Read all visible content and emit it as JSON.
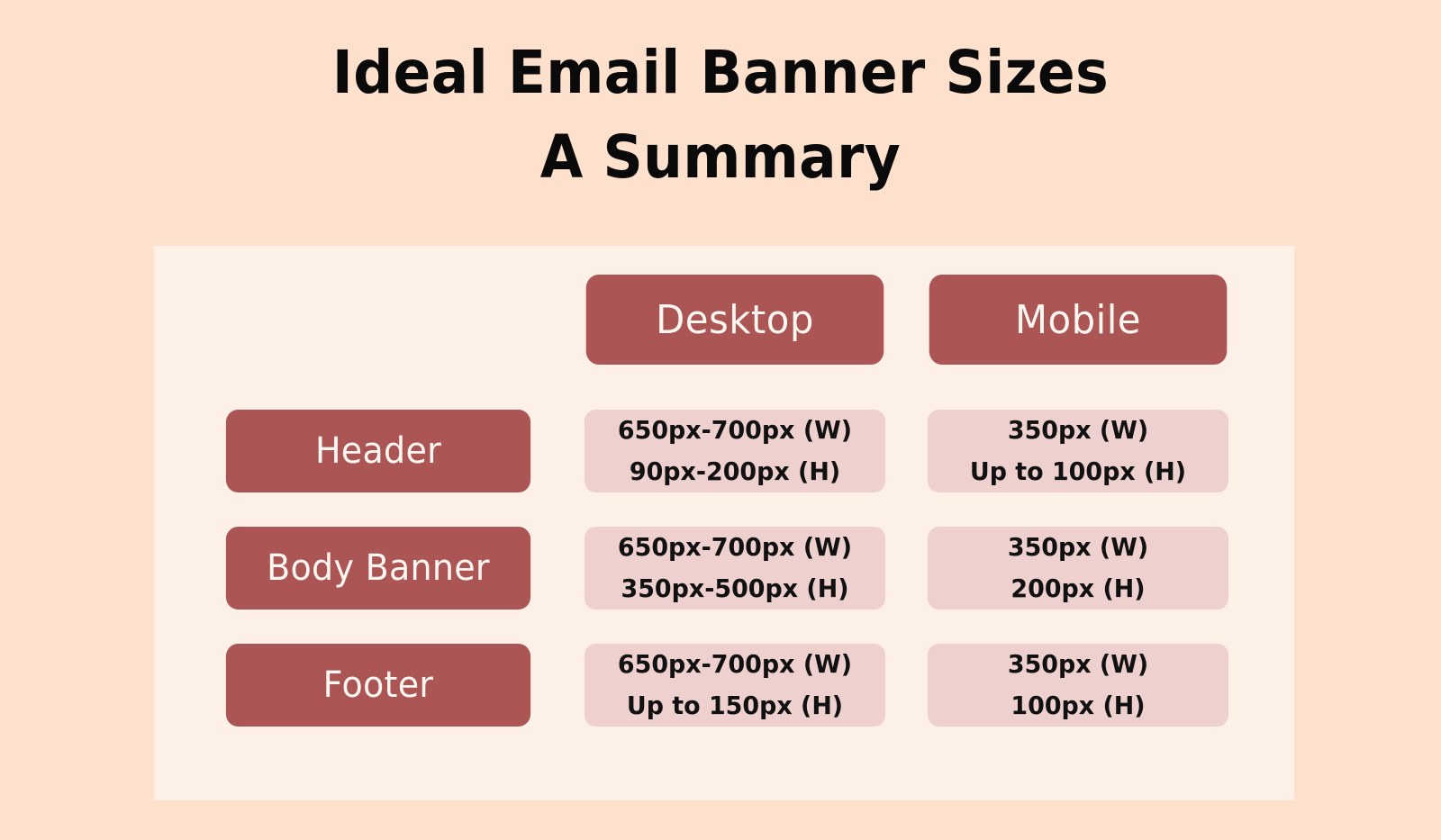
{
  "title": {
    "line1": "Ideal Email Banner Sizes",
    "line2": "A Summary"
  },
  "colors": {
    "page_background": "#FDE1CC",
    "card_background": "#FDF0E7",
    "pill_primary": "#AB5555",
    "cell_background": "#EED1CE",
    "pill_text": "#FDF6F1",
    "cell_text": "#111111",
    "title_text": "#0A0A0A"
  },
  "table": {
    "corner_label": "",
    "columns": [
      {
        "label": "Desktop"
      },
      {
        "label": "Mobile"
      }
    ],
    "rows": [
      {
        "label": "Header",
        "desktop": {
          "width": "650px-700px (W)",
          "height": "90px-200px (H)"
        },
        "mobile": {
          "width": "350px (W)",
          "height": "Up to 100px (H)"
        }
      },
      {
        "label": "Body Banner",
        "desktop": {
          "width": "650px-700px (W)",
          "height": "350px-500px (H)"
        },
        "mobile": {
          "width": "350px (W)",
          "height": "200px (H)"
        }
      },
      {
        "label": "Footer",
        "desktop": {
          "width": "650px-700px (W)",
          "height": "Up to 150px (H)"
        },
        "mobile": {
          "width": "350px (W)",
          "height": "100px (H)"
        }
      }
    ]
  }
}
